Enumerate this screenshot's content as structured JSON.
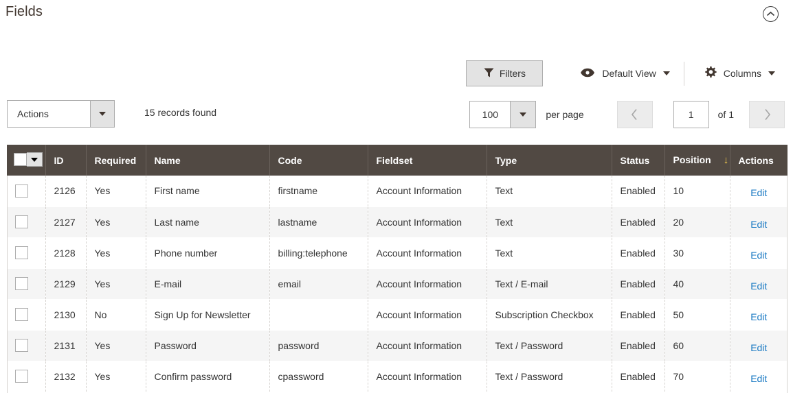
{
  "section": {
    "title": "Fields",
    "collapse_icon": "chevron-up-circle-icon"
  },
  "toolbar": {
    "filters_label": "Filters",
    "filters_icon": "funnel-icon",
    "view_label": "Default View",
    "view_icon": "eye-icon",
    "columns_label": "Columns",
    "columns_icon": "gear-icon"
  },
  "controls": {
    "actions_label": "Actions",
    "records_found": "15 records found",
    "per_page_value": "100",
    "per_page_label": "per page",
    "page_value": "1",
    "page_of": "of 1",
    "prev_icon": "chevron-left-icon",
    "next_icon": "chevron-right-icon"
  },
  "grid": {
    "columns": [
      {
        "key": "check",
        "label": ""
      },
      {
        "key": "id",
        "label": "ID"
      },
      {
        "key": "required",
        "label": "Required"
      },
      {
        "key": "name",
        "label": "Name"
      },
      {
        "key": "code",
        "label": "Code"
      },
      {
        "key": "fieldset",
        "label": "Fieldset"
      },
      {
        "key": "type",
        "label": "Type"
      },
      {
        "key": "status",
        "label": "Status"
      },
      {
        "key": "position",
        "label": "Position",
        "sort": "↓"
      },
      {
        "key": "actions",
        "label": "Actions"
      }
    ],
    "action_label": "Edit",
    "rows": [
      {
        "id": "2126",
        "required": "Yes",
        "name": "First name",
        "code": "firstname",
        "fieldset": "Account Information",
        "type": "Text",
        "status": "Enabled",
        "position": "10"
      },
      {
        "id": "2127",
        "required": "Yes",
        "name": "Last name",
        "code": "lastname",
        "fieldset": "Account Information",
        "type": "Text",
        "status": "Enabled",
        "position": "20"
      },
      {
        "id": "2128",
        "required": "Yes",
        "name": "Phone number",
        "code": "billing:telephone",
        "fieldset": "Account Information",
        "type": "Text",
        "status": "Enabled",
        "position": "30"
      },
      {
        "id": "2129",
        "required": "Yes",
        "name": "E-mail",
        "code": "email",
        "fieldset": "Account Information",
        "type": "Text / E-mail",
        "status": "Enabled",
        "position": "40"
      },
      {
        "id": "2130",
        "required": "No",
        "name": "Sign Up for Newsletter",
        "code": "",
        "fieldset": "Account Information",
        "type": "Subscription Checkbox",
        "status": "Enabled",
        "position": "50"
      },
      {
        "id": "2131",
        "required": "Yes",
        "name": "Password",
        "code": "password",
        "fieldset": "Account Information",
        "type": "Text / Password",
        "status": "Enabled",
        "position": "60"
      },
      {
        "id": "2132",
        "required": "Yes",
        "name": "Confirm password",
        "code": "cpassword",
        "fieldset": "Account Information",
        "type": "Text / Password",
        "status": "Enabled",
        "position": "70"
      }
    ]
  },
  "colors": {
    "header_bg": "#514943",
    "link": "#1979c3",
    "sort_arrow": "#ffd24d",
    "row_alt": "#f5f5f5"
  }
}
